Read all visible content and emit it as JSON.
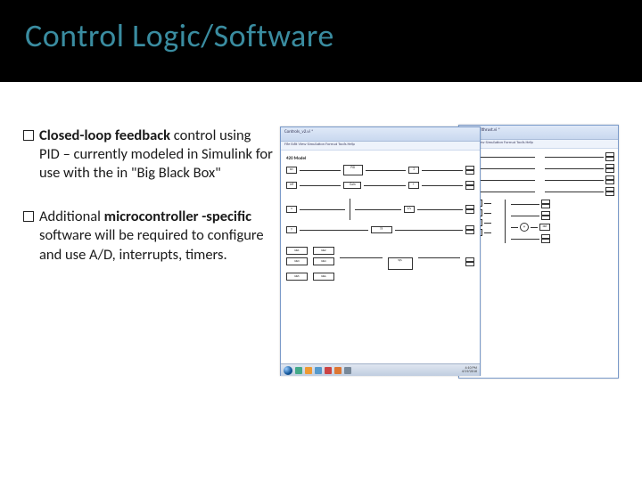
{
  "title": "Control Logic/Software",
  "bullets": [
    {
      "bold_lead": "Closed-loop feedback",
      "rest": " control using PID – currently modeled in Simulink for use with the in \"Big Black Box\""
    },
    {
      "pre": "Additional ",
      "bold_mid": "microcontroller -specific",
      "rest": " software will be required to configure and use A/D, interrupts, timers."
    }
  ],
  "screenshots": {
    "front": {
      "titlebar": "Controls_v2.vi *",
      "menu": "File  Edit  View  Simulation  Format  Tools  Help",
      "canvas_label": "420 Model"
    },
    "back": {
      "titlebar": "control_allthrust.vi *",
      "menu": "File  Edit  View  Simulation  Format  Tools  Help"
    },
    "taskbar_time": "4:10 PM",
    "taskbar_date": "4/19/2016"
  }
}
